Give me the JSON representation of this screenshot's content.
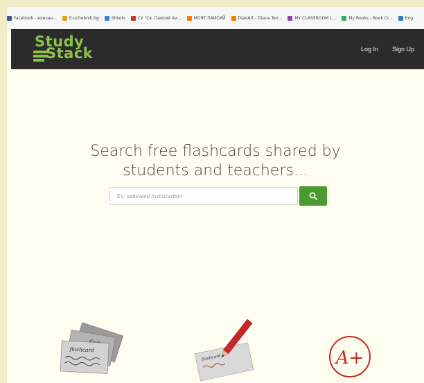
{
  "bookmarks": [
    {
      "label": "Facebook - влизан...",
      "icon": "facebook-icon",
      "color": "#3b5998"
    },
    {
      "label": "E-uchebnik.bg",
      "icon": "euchebnik-icon",
      "color": "#e8a317"
    },
    {
      "label": "Shkolo",
      "icon": "shkolo-icon",
      "color": "#2e86de"
    },
    {
      "label": "СУ \"Св. Паисий Хи...",
      "icon": "school-icon",
      "color": "#c0392b"
    },
    {
      "label": "МОЯТ ПАИСИЙ",
      "icon": "blogger-icon",
      "color": "#f57d00"
    },
    {
      "label": "DianArt - Diana Ten...",
      "icon": "blogger-icon",
      "color": "#f57d00"
    },
    {
      "label": "MY CLASSROOM L...",
      "icon": "classroom-icon",
      "color": "#8e44ad"
    },
    {
      "label": "My Books - Book Cr...",
      "icon": "bookcreator-icon",
      "color": "#27ae60"
    },
    {
      "label": "Eng",
      "icon": "wifi-icon",
      "color": "#2980b9"
    }
  ],
  "navbar": {
    "logo_line1": "Study",
    "logo_line2": "Stack",
    "login_label": "Log In",
    "signup_label": "Sign Up"
  },
  "hero": {
    "line1": "Search free flashcards shared by",
    "line2": "students and teachers..."
  },
  "search": {
    "placeholder": "Ex: saturated hydrocarbon",
    "button_icon": "search-icon"
  },
  "features": {
    "flashcard_texts": [
      "flash",
      "flash",
      "flashcard"
    ],
    "pencil_text": "flashcard",
    "grade_text": "A+"
  },
  "colors": {
    "brand_green": "#8bc34a",
    "button_green": "#4a9a30",
    "navbar_bg": "#2b2b2b",
    "page_bg": "#fffdf0",
    "grade_red": "#c62828"
  }
}
